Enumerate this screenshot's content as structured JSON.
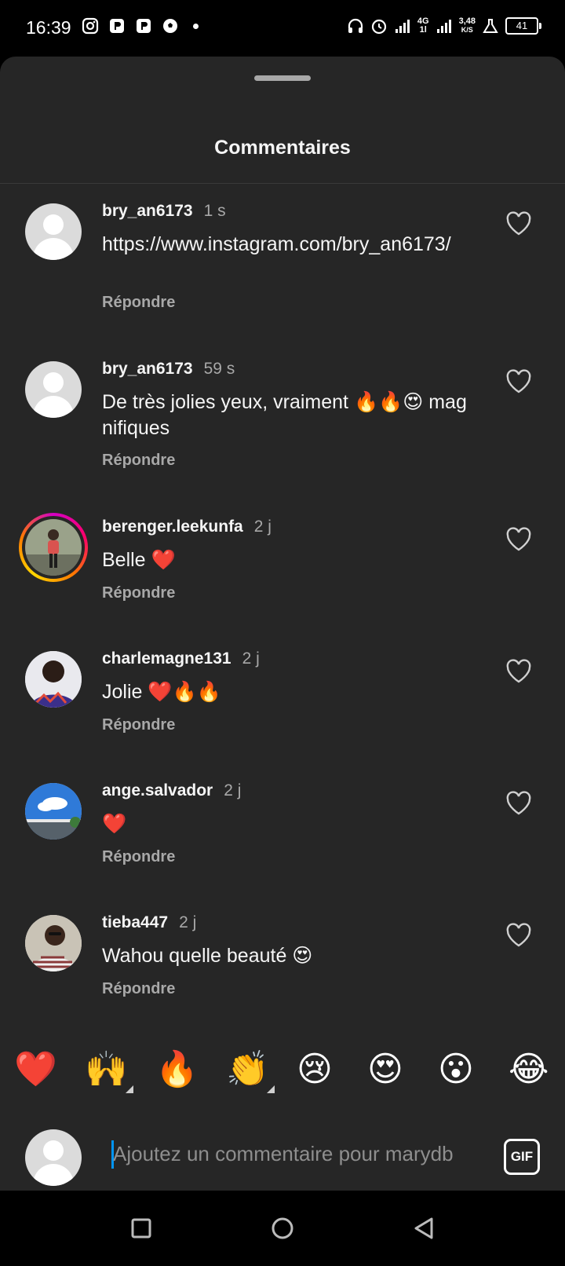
{
  "status_bar": {
    "time": "16:39",
    "network_top": "4G",
    "network_bottom": "1l",
    "speed_top": "3,48",
    "speed_bottom": "K/S",
    "battery": "41"
  },
  "sheet": {
    "title": "Commentaires"
  },
  "comments": [
    {
      "username": "bry_an6173",
      "time": "1 s",
      "text": "https://www.instagram.com/bry_an6173/",
      "reply": "Répondre",
      "avatar": "default-avatar"
    },
    {
      "username": "bry_an6173",
      "time": "59 s",
      "text": "De très jolies yeux, vraiment 🔥🔥😍 magnifiques",
      "reply": "Répondre",
      "avatar": "default-avatar"
    },
    {
      "username": "berenger.leekunfa",
      "time": "2 j",
      "text": "Belle ❤️",
      "reply": "Répondre",
      "avatar": "photo-story-ring"
    },
    {
      "username": "charlemagne131",
      "time": "2 j",
      "text": "Jolie ❤️🔥🔥",
      "reply": "Répondre",
      "avatar": "photo"
    },
    {
      "username": "ange.salvador",
      "time": "2 j",
      "text": "❤️",
      "reply": "Répondre",
      "avatar": "photo-sky"
    },
    {
      "username": "tieba447",
      "time": "2 j",
      "text": "Wahou quelle beauté 😍",
      "reply": "Répondre",
      "avatar": "photo"
    }
  ],
  "emoji_bar": [
    "❤️",
    "🙌",
    "🔥",
    "👏",
    "😢",
    "😍",
    "😮",
    "😂"
  ],
  "composer": {
    "placeholder": "Ajoutez un commentaire pour marydb",
    "gif_label": "GIF"
  },
  "colors": {
    "background": "#262626",
    "muted": "#a8a8a8",
    "accent": "#0095f6"
  }
}
